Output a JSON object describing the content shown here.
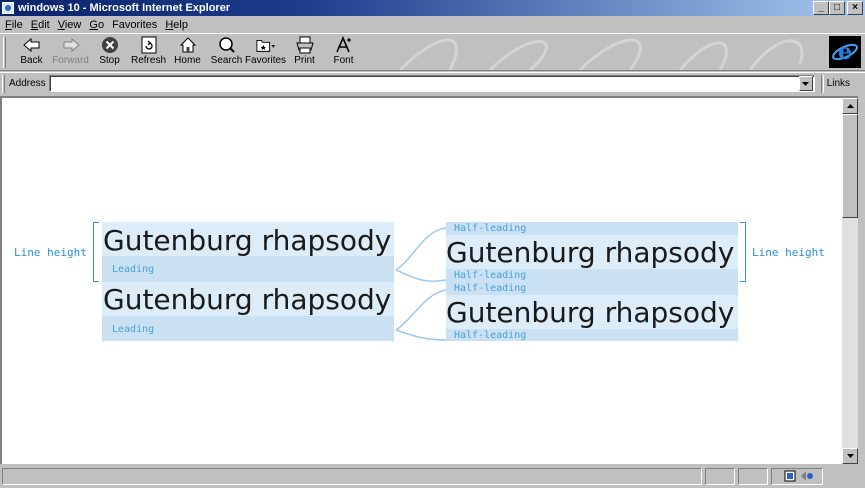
{
  "window": {
    "title": "windows 10 - Microsoft Internet Explorer",
    "buttons": [
      "_",
      "□",
      "×"
    ]
  },
  "menu": {
    "items": [
      {
        "key": "F",
        "rest": "ile"
      },
      {
        "key": "E",
        "rest": "dit"
      },
      {
        "key": "V",
        "rest": "iew"
      },
      {
        "key": "G",
        "rest": "o"
      },
      {
        "key": "",
        "rest": "Favorites"
      },
      {
        "key": "H",
        "rest": "elp"
      }
    ]
  },
  "toolbar": {
    "back": "Back",
    "forward": "Forward",
    "stop": "Stop",
    "refresh": "Refresh",
    "home": "Home",
    "search": "Search",
    "favorites": "Favorites",
    "print": "Print",
    "font": "Font"
  },
  "address": {
    "label": "Address",
    "value": "",
    "links_label": "Links"
  },
  "diagram": {
    "left_side_label": "Line height",
    "right_side_label": "Line height",
    "sample_text": "Gutenburg rhapsody",
    "leading_label": "Leading",
    "half_leading_label": "Half-leading"
  },
  "status": {
    "text": ""
  },
  "colors": {
    "accent_blue": "#3a8fd8",
    "band_blue": "#c9e1f3",
    "title_gradient_start": "#0a246a"
  }
}
